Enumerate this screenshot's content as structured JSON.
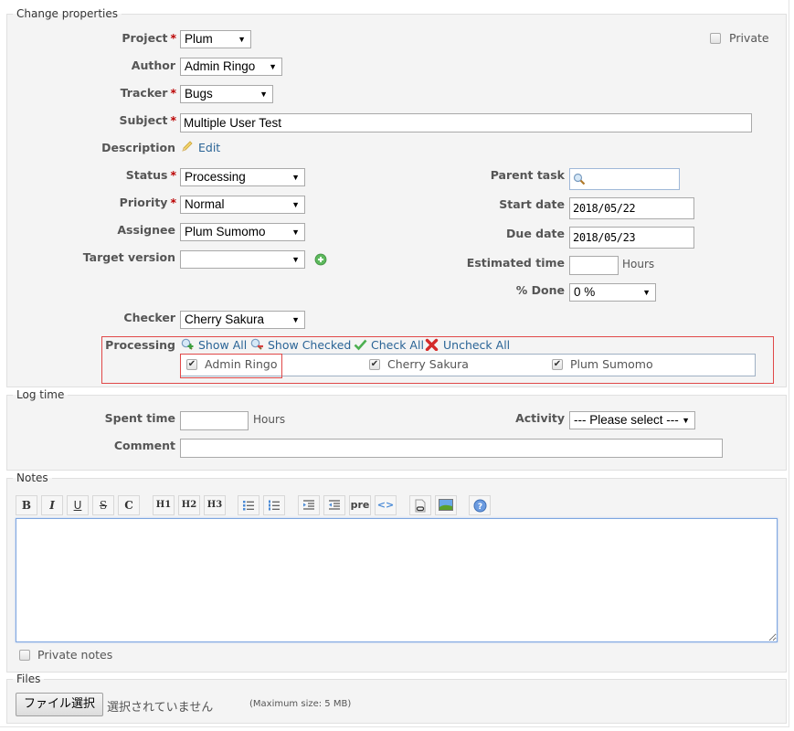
{
  "change_properties": {
    "legend": "Change properties",
    "project": {
      "label": "Project",
      "value": "Plum"
    },
    "private": {
      "label": "Private",
      "checked": false
    },
    "author": {
      "label": "Author",
      "value": "Admin Ringo"
    },
    "tracker": {
      "label": "Tracker",
      "value": "Bugs"
    },
    "subject": {
      "label": "Subject",
      "value": "Multiple User Test"
    },
    "description": {
      "label": "Description",
      "edit_link": "Edit"
    },
    "status": {
      "label": "Status",
      "value": "Processing"
    },
    "priority": {
      "label": "Priority",
      "value": "Normal"
    },
    "assignee": {
      "label": "Assignee",
      "value": "Plum Sumomo"
    },
    "target_version": {
      "label": "Target version",
      "value": ""
    },
    "parent_task": {
      "label": "Parent task",
      "value": ""
    },
    "start_date": {
      "label": "Start date",
      "value": "2018/05/22"
    },
    "due_date": {
      "label": "Due date",
      "value": "2018/05/23"
    },
    "estimated_time": {
      "label": "Estimated time",
      "value": "",
      "unit": "Hours"
    },
    "done_ratio": {
      "label": "% Done",
      "value": "0 %"
    },
    "checker": {
      "label": "Checker",
      "value": "Cherry Sakura"
    },
    "processing": {
      "label": "Processing",
      "actions": {
        "show_all": "Show All",
        "show_checked": "Show Checked",
        "check_all": "Check All",
        "uncheck_all": "Uncheck All"
      },
      "users": [
        {
          "name": "Admin Ringo",
          "checked": true
        },
        {
          "name": "Cherry Sakura",
          "checked": true
        },
        {
          "name": "Plum Sumomo",
          "checked": true
        }
      ]
    },
    "required_mark": "*"
  },
  "log_time": {
    "legend": "Log time",
    "spent_time": {
      "label": "Spent time",
      "value": "",
      "unit": "Hours"
    },
    "activity": {
      "label": "Activity",
      "value": "--- Please select ---"
    },
    "comment": {
      "label": "Comment",
      "value": ""
    }
  },
  "notes": {
    "legend": "Notes",
    "toolbar": [
      {
        "name": "bold",
        "glyph": "B"
      },
      {
        "name": "italic",
        "glyph": "I"
      },
      {
        "name": "underline",
        "glyph": "U"
      },
      {
        "name": "strikethrough",
        "glyph": "S"
      },
      {
        "name": "inline-code",
        "glyph": "C"
      },
      {
        "name": "heading-1",
        "glyph": "H1"
      },
      {
        "name": "heading-2",
        "glyph": "H2"
      },
      {
        "name": "heading-3",
        "glyph": "H3"
      },
      {
        "name": "unordered-list",
        "glyph": ""
      },
      {
        "name": "ordered-list",
        "glyph": ""
      },
      {
        "name": "indent",
        "glyph": ""
      },
      {
        "name": "outdent",
        "glyph": ""
      },
      {
        "name": "preformatted",
        "glyph": "pre"
      },
      {
        "name": "code-highlight",
        "glyph": "<>"
      },
      {
        "name": "link",
        "glyph": ""
      },
      {
        "name": "image",
        "glyph": ""
      },
      {
        "name": "help",
        "glyph": "?"
      }
    ],
    "value": "",
    "private_notes": {
      "label": "Private notes",
      "checked": false
    }
  },
  "files": {
    "legend": "Files",
    "choose_button": "ファイル選択",
    "no_file": "選択されていません",
    "max_size": "(Maximum size: 5 MB)"
  }
}
